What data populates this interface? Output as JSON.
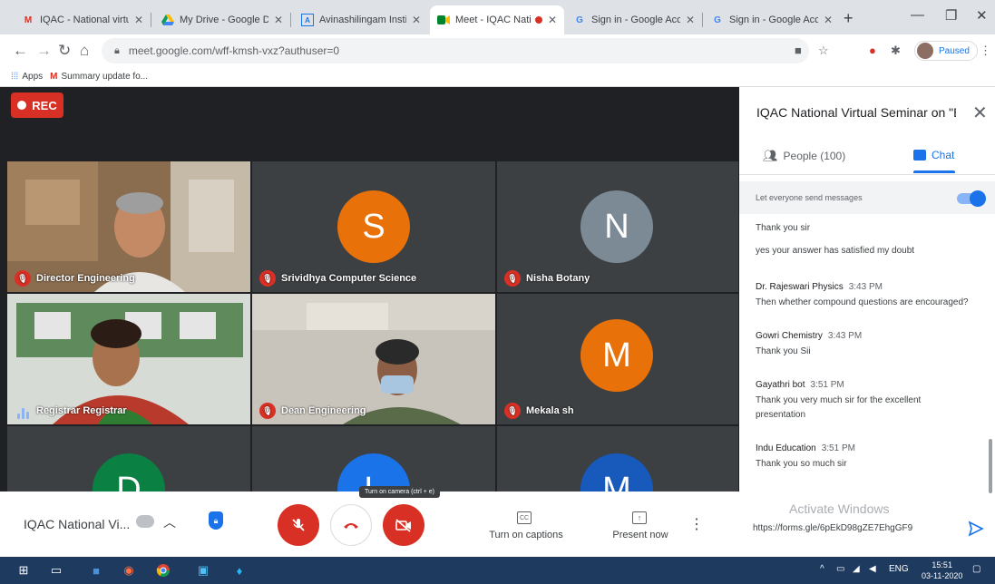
{
  "browser": {
    "tabs": [
      {
        "title": "IQAC - National virtual",
        "icon": "gmail-icon",
        "active": false
      },
      {
        "title": "My Drive - Google Dri...",
        "icon": "drive-icon",
        "active": false
      },
      {
        "title": "Avinashilingam Instituti...",
        "icon": "site-icon",
        "active": false
      },
      {
        "title": "Meet - IQAC Natio...",
        "icon": "meet-icon",
        "active": true
      },
      {
        "title": "Sign in - Google Accou...",
        "icon": "google-icon",
        "active": false
      },
      {
        "title": "Sign in - Google Accou...",
        "icon": "google-icon",
        "active": false
      }
    ],
    "url": "meet.google.com/wff-kmsh-vxz?authuser=0",
    "profile_label": "Paused",
    "bookmarks": [
      {
        "label": "Apps",
        "icon": "apps-grid-icon"
      },
      {
        "label": "Summary update fo...",
        "icon": "gmail-icon"
      }
    ]
  },
  "meet": {
    "rec_label": "REC",
    "participants": [
      {
        "name": "Director Engineering",
        "type": "video",
        "mic": "off"
      },
      {
        "name": "Srividhya Computer Science",
        "type": "avatar",
        "initial": "S",
        "color": "#e8710a",
        "mic": "off"
      },
      {
        "name": "Nisha Botany",
        "type": "avatar",
        "initial": "N",
        "color": "#7b8a94",
        "mic": "off"
      },
      {
        "name": "Registrar Registrar",
        "type": "video",
        "mic": "speaking"
      },
      {
        "name": "Dean Engineering",
        "type": "video",
        "mic": "off"
      },
      {
        "name": "Mekala sh",
        "type": "avatar",
        "initial": "M",
        "color": "#e8710a",
        "mic": "off"
      },
      {
        "name": "",
        "type": "avatar",
        "initial": "D",
        "color": "#0b8043",
        "mic": "none"
      },
      {
        "name": "",
        "type": "avatar",
        "initial": "L",
        "color": "#1a73e8",
        "mic": "none"
      },
      {
        "name": "",
        "type": "avatar",
        "initial": "M",
        "color": "#185abc",
        "mic": "none"
      }
    ],
    "controls": {
      "meeting_title": "IQAC National Vi...",
      "tooltip": "Turn on camera (ctrl + e)",
      "captions_label": "Turn on captions",
      "present_label": "Present now",
      "cc_glyph": "CC"
    }
  },
  "panel": {
    "title": "IQAC National Virtual Seminar on \"E...",
    "people_tab": "People (100)",
    "chat_tab": "Chat",
    "toggle_label": "Let everyone send messages",
    "messages_plain": [
      "Thank you sir",
      "yes your answer has satisfied my doubt"
    ],
    "messages": [
      {
        "sender": "Dr. Rajeswari Physics",
        "time": "3:43 PM",
        "text": "Then whether compound questions are encouraged?"
      },
      {
        "sender": "Gowri Chemistry",
        "time": "3:43 PM",
        "text": "Thank you Sii"
      },
      {
        "sender": "Gayathri bot",
        "time": "3:51 PM",
        "text": "Thank you very much sir for the excellent presentation"
      },
      {
        "sender": "Indu Education",
        "time": "3:51 PM",
        "text": "Thank you so much sir"
      }
    ],
    "chat_input_value": "https://forms.gle/6pEkD98gZE7EhgGF9",
    "watermark": "Activate Windows"
  },
  "taskbar": {
    "lang": "ENG",
    "time": "15:51",
    "date": "03-11-2020"
  },
  "colors": {
    "meet_bg": "#202124",
    "accent": "#1a73e8",
    "danger": "#d93025"
  }
}
